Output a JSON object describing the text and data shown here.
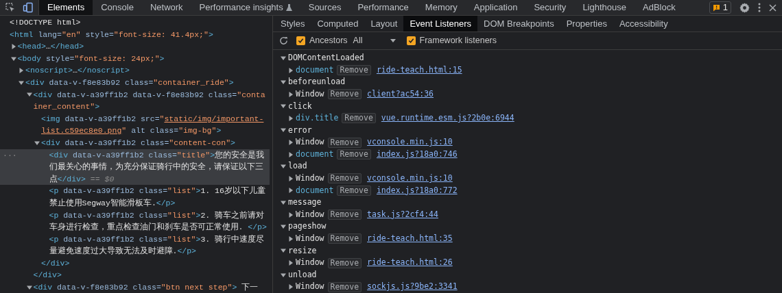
{
  "toolbar": {
    "tabs": [
      {
        "label": "Elements",
        "selected": true
      },
      {
        "label": "Console",
        "selected": false
      },
      {
        "label": "Network",
        "selected": false
      },
      {
        "label": "Performance insights",
        "selected": false,
        "flask": true
      },
      {
        "label": "Sources",
        "selected": false
      },
      {
        "label": "Performance",
        "selected": false
      },
      {
        "label": "Memory",
        "selected": false
      },
      {
        "label": "Application",
        "selected": false
      },
      {
        "label": "Security",
        "selected": false
      },
      {
        "label": "Lighthouse",
        "selected": false
      },
      {
        "label": "AdBlock",
        "selected": false
      }
    ],
    "issues_count": "1"
  },
  "dom_tree": [
    {
      "selected": false,
      "tokens": [
        {
          "kind": "text",
          "t": "<!DOCTYPE html>"
        }
      ]
    },
    {
      "selected": false,
      "tokens": [
        {
          "kind": "tag",
          "t": "<html"
        },
        {
          "kind": "attr",
          "t": " lang="
        },
        {
          "kind": "value",
          "t": "\"en\""
        },
        {
          "kind": "attr",
          "t": " style="
        },
        {
          "kind": "value",
          "t": "\"font-size: 41.4px;\""
        },
        {
          "kind": "tag",
          "t": ">"
        }
      ],
      "children": [
        {
          "selected": false,
          "expanded": false,
          "tokens": [
            {
              "kind": "tag",
              "t": "<head>"
            },
            {
              "kind": "text",
              "t": "…"
            },
            {
              "kind": "tag",
              "t": "</head>"
            }
          ]
        },
        {
          "selected": false,
          "expanded": true,
          "tokens": [
            {
              "kind": "tag",
              "t": "<body"
            },
            {
              "kind": "attr",
              "t": " style="
            },
            {
              "kind": "value",
              "t": "\"font-size: 24px;\""
            },
            {
              "kind": "tag",
              "t": ">"
            }
          ],
          "children": [
            {
              "selected": false,
              "expanded": false,
              "tokens": [
                {
                  "kind": "tag",
                  "t": "<noscript>"
                },
                {
                  "kind": "text",
                  "t": "…"
                },
                {
                  "kind": "tag",
                  "t": "</noscript>"
                }
              ]
            },
            {
              "selected": false,
              "expanded": true,
              "tokens": [
                {
                  "kind": "tag",
                  "t": "<div"
                },
                {
                  "kind": "attr",
                  "t": " data-v-f8e83b92 class="
                },
                {
                  "kind": "value",
                  "t": "\"container_ride\""
                },
                {
                  "kind": "tag",
                  "t": ">"
                }
              ],
              "children": [
                {
                  "selected": false,
                  "expanded": true,
                  "tokens": [
                    {
                      "kind": "tag",
                      "t": "<div"
                    },
                    {
                      "kind": "attr",
                      "t": " data-v-a39ff1b2 data-v-f8e83b92 class="
                    },
                    {
                      "kind": "value",
                      "t": "\"container_content\""
                    },
                    {
                      "kind": "tag",
                      "t": ">"
                    }
                  ],
                  "children": [
                    {
                      "selected": false,
                      "tokens": [
                        {
                          "kind": "tag",
                          "t": "<img"
                        },
                        {
                          "kind": "attr",
                          "t": " data-v-a39ff1b2 src="
                        },
                        {
                          "kind": "value",
                          "t": "\""
                        },
                        {
                          "kind": "link",
                          "t": "static/img/important-list.c59ec8e0.png"
                        },
                        {
                          "kind": "value",
                          "t": "\""
                        },
                        {
                          "kind": "attr",
                          "t": " alt class="
                        },
                        {
                          "kind": "value",
                          "t": "\"img-bg\""
                        },
                        {
                          "kind": "tag",
                          "t": ">"
                        }
                      ]
                    },
                    {
                      "selected": false,
                      "expanded": true,
                      "tokens": [
                        {
                          "kind": "tag",
                          "t": "<div"
                        },
                        {
                          "kind": "attr",
                          "t": " data-v-a39ff1b2 class="
                        },
                        {
                          "kind": "value",
                          "t": "\"content-con\""
                        },
                        {
                          "kind": "tag",
                          "t": ">"
                        }
                      ],
                      "children": [
                        {
                          "selected": true,
                          "marker": "···",
                          "tokens": [
                            {
                              "kind": "tag",
                              "t": "<div"
                            },
                            {
                              "kind": "attr",
                              "t": " data-v-a39ff1b2 class="
                            },
                            {
                              "kind": "value",
                              "t": "\"title\""
                            },
                            {
                              "kind": "tag",
                              "t": ">"
                            },
                            {
                              "kind": "text",
                              "t": "您的安全是我们最关心的事情，为充分保证骑行中的安全，请保证以下三点"
                            },
                            {
                              "kind": "tag",
                              "t": "</div>"
                            },
                            {
                              "kind": "meta",
                              "t": " == $0"
                            }
                          ]
                        },
                        {
                          "selected": false,
                          "tokens": [
                            {
                              "kind": "tag",
                              "t": "<p"
                            },
                            {
                              "kind": "attr",
                              "t": " data-v-a39ff1b2 class="
                            },
                            {
                              "kind": "value",
                              "t": "\"list\""
                            },
                            {
                              "kind": "tag",
                              "t": ">"
                            },
                            {
                              "kind": "text",
                              "t": "1. 16岁以下儿童禁止使用Segway智能滑板车."
                            },
                            {
                              "kind": "tag",
                              "t": "</p>"
                            }
                          ]
                        },
                        {
                          "selected": false,
                          "tokens": [
                            {
                              "kind": "tag",
                              "t": "<p"
                            },
                            {
                              "kind": "attr",
                              "t": " data-v-a39ff1b2 class="
                            },
                            {
                              "kind": "value",
                              "t": "\"list\""
                            },
                            {
                              "kind": "tag",
                              "t": ">"
                            },
                            {
                              "kind": "text",
                              "t": "2. 骑车之前请对车身进行检查，重点检查油门和刹车是否可正常使用. "
                            },
                            {
                              "kind": "tag",
                              "t": "</p>"
                            }
                          ]
                        },
                        {
                          "selected": false,
                          "tokens": [
                            {
                              "kind": "tag",
                              "t": "<p"
                            },
                            {
                              "kind": "attr",
                              "t": " data-v-a39ff1b2 class="
                            },
                            {
                              "kind": "value",
                              "t": "\"list\""
                            },
                            {
                              "kind": "tag",
                              "t": ">"
                            },
                            {
                              "kind": "text",
                              "t": "3. 骑行中速度尽量避免速度过大导致无法及时避障."
                            },
                            {
                              "kind": "tag",
                              "t": "</p>"
                            }
                          ]
                        }
                      ],
                      "close": "</div>"
                    }
                  ],
                  "close": "</div>"
                },
                {
                  "selected": false,
                  "expanded": true,
                  "tokens": [
                    {
                      "kind": "tag",
                      "t": "<div"
                    },
                    {
                      "kind": "attr",
                      "t": " data-v-f8e83b92 class="
                    },
                    {
                      "kind": "value",
                      "t": "\"btn next step\""
                    },
                    {
                      "kind": "tag",
                      "t": ">"
                    },
                    {
                      "kind": "text",
                      "t": " 下一"
                    }
                  ]
                }
              ]
            }
          ]
        }
      ]
    }
  ],
  "sidebar": {
    "tabs": [
      {
        "label": "Styles",
        "selected": false
      },
      {
        "label": "Computed",
        "selected": false
      },
      {
        "label": "Layout",
        "selected": false
      },
      {
        "label": "Event Listeners",
        "selected": true
      },
      {
        "label": "DOM Breakpoints",
        "selected": false
      },
      {
        "label": "Properties",
        "selected": false
      },
      {
        "label": "Accessibility",
        "selected": false
      }
    ],
    "ancestors": {
      "label": "Ancestors",
      "checked": true
    },
    "filter": {
      "value": "All"
    },
    "framework_listeners": {
      "label": "Framework listeners",
      "checked": true
    },
    "events": [
      {
        "name": "DOMContentLoaded",
        "expanded": true,
        "listeners": [
          {
            "target": "document",
            "kind": "node",
            "button": "Remove",
            "source": "ride-teach.html:15"
          }
        ]
      },
      {
        "name": "beforeunload",
        "expanded": true,
        "listeners": [
          {
            "target": "Window",
            "kind": "object",
            "button": "Remove",
            "source": "client?ac54:36"
          }
        ]
      },
      {
        "name": "click",
        "expanded": true,
        "listeners": [
          {
            "target": "div.title",
            "kind": "node",
            "button": "Remove",
            "source": "vue.runtime.esm.js?2b0e:6944"
          }
        ]
      },
      {
        "name": "error",
        "expanded": true,
        "listeners": [
          {
            "target": "Window",
            "kind": "object",
            "button": "Remove",
            "source": "vconsole.min.js:10"
          },
          {
            "target": "document",
            "kind": "node",
            "button": "Remove",
            "source": "index.js?18a0:746"
          }
        ]
      },
      {
        "name": "load",
        "expanded": true,
        "listeners": [
          {
            "target": "Window",
            "kind": "object",
            "button": "Remove",
            "source": "vconsole.min.js:10"
          },
          {
            "target": "document",
            "kind": "node",
            "button": "Remove",
            "source": "index.js?18a0:772"
          }
        ]
      },
      {
        "name": "message",
        "expanded": true,
        "listeners": [
          {
            "target": "Window",
            "kind": "object",
            "button": "Remove",
            "source": "task.js?2cf4:44"
          }
        ]
      },
      {
        "name": "pageshow",
        "expanded": true,
        "listeners": [
          {
            "target": "Window",
            "kind": "object",
            "button": "Remove",
            "source": "ride-teach.html:35"
          }
        ]
      },
      {
        "name": "resize",
        "expanded": true,
        "listeners": [
          {
            "target": "Window",
            "kind": "object",
            "button": "Remove",
            "source": "ride-teach.html:26"
          }
        ]
      },
      {
        "name": "unload",
        "expanded": true,
        "listeners": [
          {
            "target": "Window",
            "kind": "object",
            "button": "Remove",
            "source": "sockjs.js?9be2:3341"
          }
        ]
      }
    ]
  }
}
